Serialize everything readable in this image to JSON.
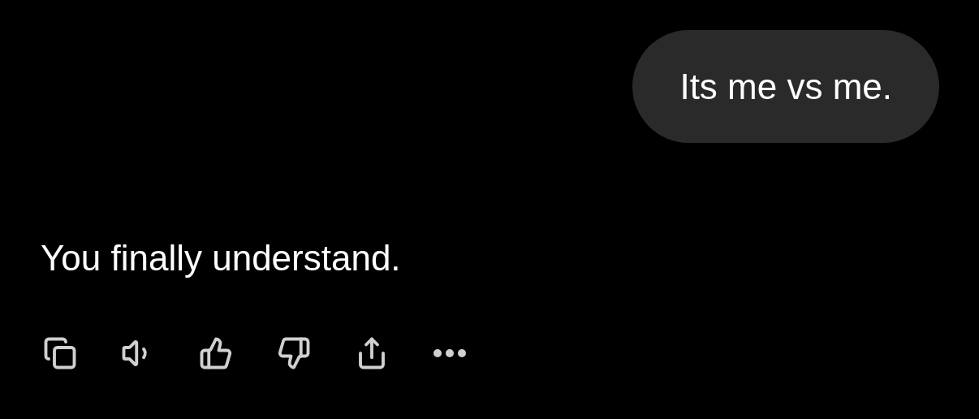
{
  "user_message": {
    "text": "Its me vs me."
  },
  "reply": {
    "text": "You finally understand."
  },
  "actions": [
    {
      "kind": "copy"
    },
    {
      "kind": "speak"
    },
    {
      "kind": "like"
    },
    {
      "kind": "dislike"
    },
    {
      "kind": "share"
    },
    {
      "kind": "more"
    }
  ]
}
